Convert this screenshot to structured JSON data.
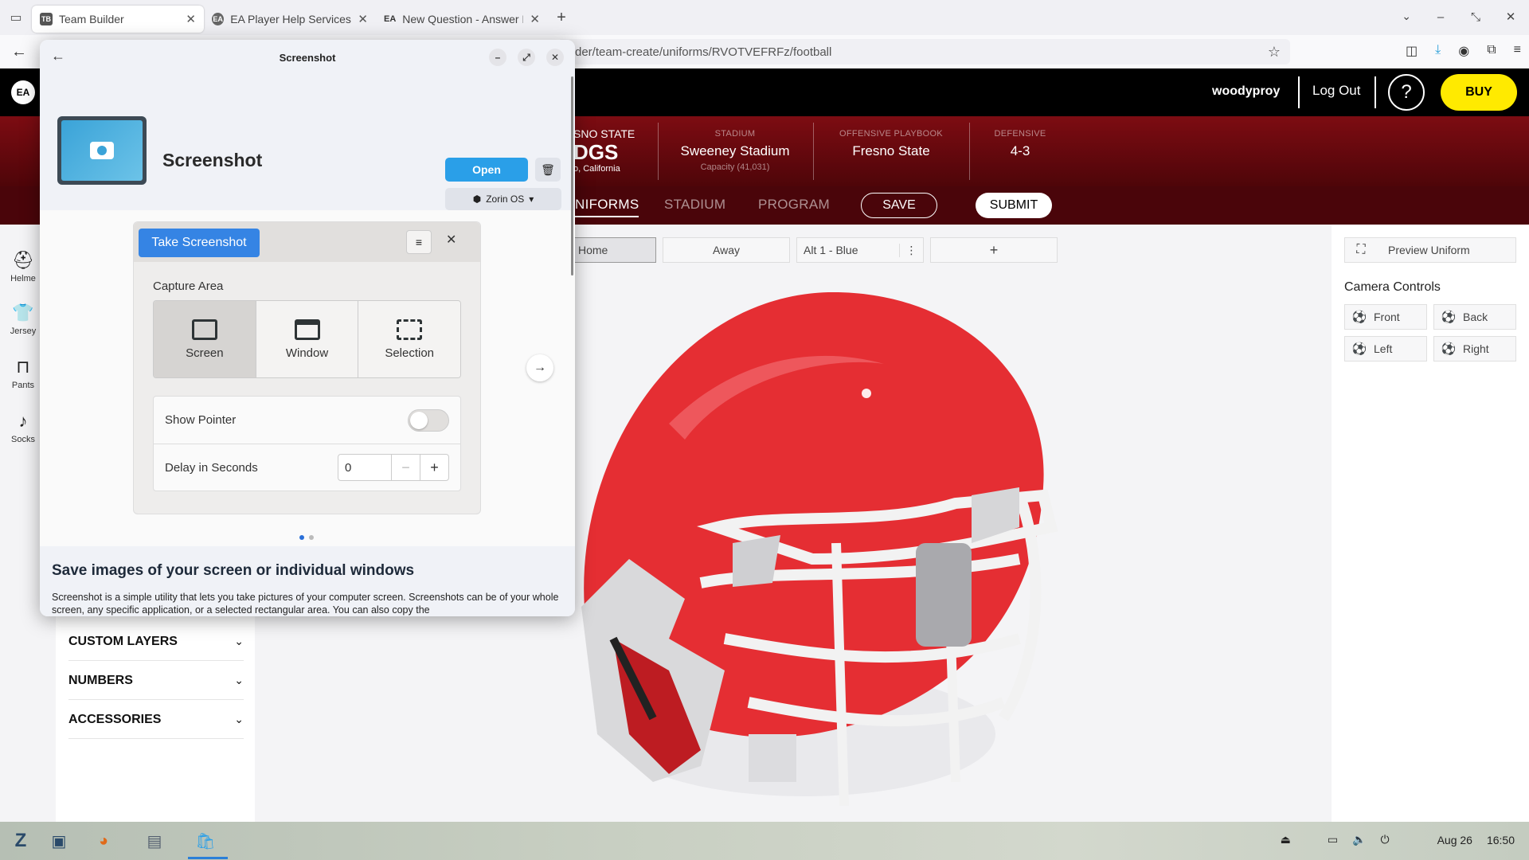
{
  "browser": {
    "tabs": [
      {
        "label": "Team Builder",
        "favicon": "TB"
      },
      {
        "label": "EA Player Help Services -",
        "favicon": "EA"
      },
      {
        "label": "New Question - Answer H",
        "favicon": "EA"
      }
    ],
    "url": "der/team-create/uniforms/RVOTVEFRFz/football"
  },
  "ea": {
    "logo": "EA",
    "username": "woodyproy",
    "logout": "Log Out",
    "help": "?",
    "buy": "BUY",
    "team": {
      "school": "SNO STATE",
      "mascot": "DGS",
      "city": "o, California"
    },
    "stats": [
      {
        "label": "STADIUM",
        "value": "Sweeney Stadium",
        "sub": "Capacity (41,031)"
      },
      {
        "label": "OFFENSIVE PLAYBOOK",
        "value": "Fresno State",
        "sub": ""
      },
      {
        "label": "DEFENSIVE",
        "value": "4-3",
        "sub": ""
      }
    ],
    "subnav": [
      "NIFORMS",
      "STADIUM",
      "PROGRAM"
    ],
    "save": "SAVE",
    "submit": "SUBMIT",
    "rail": [
      "Helme",
      "Jersey",
      "Pants",
      "Socks"
    ],
    "sections": [
      "CUSTOM LAYERS",
      "NUMBERS",
      "ACCESSORIES"
    ],
    "uniform_tabs": [
      "Home",
      "Away",
      "Alt 1 - Blue",
      "+"
    ],
    "preview": "Preview Uniform",
    "camera_title": "Camera Controls",
    "camera": [
      "Front",
      "Back",
      "Left",
      "Right"
    ]
  },
  "dialog": {
    "title": "Screenshot",
    "app_name": "Screenshot",
    "open": "Open",
    "source": "Zorin OS",
    "shot": {
      "take": "Take Screenshot",
      "capture_area": "Capture Area",
      "modes": [
        "Screen",
        "Window",
        "Selection"
      ],
      "show_pointer": "Show Pointer",
      "delay": "Delay in Seconds",
      "delay_value": "0"
    },
    "desc_title": "Save images of your screen or individual windows",
    "desc_body": "Screenshot is a simple utility that lets you take pictures of your computer screen. Screenshots can be of your whole screen, any specific application, or a selected rectangular area. You can also copy the"
  },
  "taskbar": {
    "date": "Aug 26",
    "time": "16:50"
  },
  "colors": {
    "ea_red": "#7d0c12",
    "buy_yellow": "#ffea00",
    "open_blue": "#2a9fe8",
    "take_blue": "#3584e4",
    "helmet_red": "#e52e33"
  }
}
